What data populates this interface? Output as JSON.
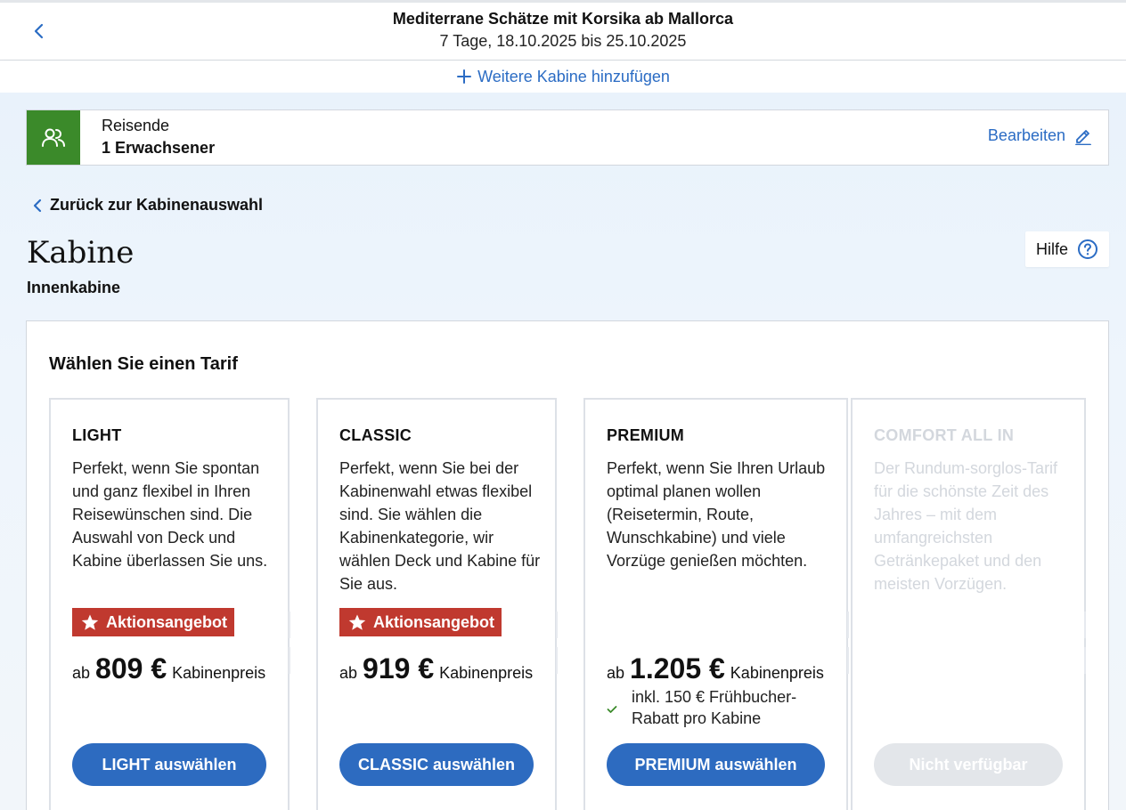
{
  "header": {
    "title": "Mediterrane Schätze mit Korsika ab Mallorca",
    "dates": "7 Tage, 18.10.2025 bis 25.10.2025",
    "add_cabin": "Weitere Kabine hinzufügen"
  },
  "travelers": {
    "label": "Reisende",
    "value": "1 Erwachsener",
    "edit": "Bearbeiten"
  },
  "nav": {
    "back_label": "Zurück zur Kabinenauswahl"
  },
  "page": {
    "title": "Kabine",
    "subtitle": "Innenkabine",
    "help": "Hilfe"
  },
  "tariffs": {
    "title": "Wählen Sie einen Tarif",
    "cards": [
      {
        "name": "LIGHT",
        "description": "Perfekt, wenn Sie spontan und ganz flexibel in Ihren Reisewünschen sind. Die Auswahl von Deck und Kabine überlassen Sie uns.",
        "promo": "Aktionsangebot",
        "price_prefix": "ab",
        "price": "809 €",
        "price_suffix": "Kabinenpreis",
        "button": "LIGHT auswählen"
      },
      {
        "name": "CLASSIC",
        "description": "Perfekt, wenn Sie bei der Kabinenwahl etwas flexibel sind. Sie wählen die Kabinenkategorie, wir wählen Deck und Kabine für Sie aus.",
        "promo": "Aktionsangebot",
        "price_prefix": "ab",
        "price": "919 €",
        "price_suffix": "Kabinenpreis",
        "button": "CLASSIC auswählen"
      },
      {
        "name": "PREMIUM",
        "description": "Perfekt, wenn Sie Ihren Urlaub optimal planen wollen (Reisetermin, Route, Wunschkabine) und viele Vorzüge genießen möchten.",
        "price_prefix": "ab",
        "price": "1.205 €",
        "price_suffix": "Kabinenpreis",
        "discount": "inkl. 150 € Frühbucher-Rabatt pro Kabine",
        "button": "PREMIUM auswählen"
      },
      {
        "name": "COMFORT ALL IN",
        "description": "Der Rundum-sorglos-Tarif für die schönste Zeit des Jahres – mit dem umfangreichsten Getränkepaket und den meisten Vorzügen.",
        "button": "Nicht verfügbar"
      }
    ]
  },
  "colors": {
    "brand_blue": "#2d6bc0",
    "link_blue": "#2b6cc4",
    "promo_red": "#c0392f",
    "traveler_green": "#3b8a2a",
    "disabled_gray": "#e3e6ea"
  }
}
